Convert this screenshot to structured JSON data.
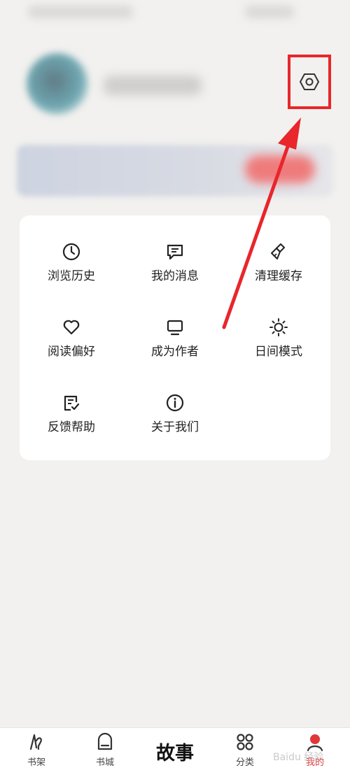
{
  "menu": {
    "items": [
      {
        "label": "浏览历史",
        "icon": "clock-icon"
      },
      {
        "label": "我的消息",
        "icon": "message-icon"
      },
      {
        "label": "清理缓存",
        "icon": "broom-icon"
      },
      {
        "label": "阅读偏好",
        "icon": "heart-icon"
      },
      {
        "label": "成为作者",
        "icon": "monitor-icon"
      },
      {
        "label": "日间模式",
        "icon": "sun-icon"
      },
      {
        "label": "反馈帮助",
        "icon": "feedback-icon"
      },
      {
        "label": "关于我们",
        "icon": "info-icon"
      }
    ]
  },
  "settings": {
    "icon": "settings-hexagon-icon"
  },
  "annotation": {
    "color": "#e8262b"
  },
  "tabbar": {
    "tabs": [
      {
        "label": "书架",
        "icon": "bookshelf-icon"
      },
      {
        "label": "书城",
        "icon": "bookstore-icon"
      },
      {
        "label": "故事"
      },
      {
        "label": "分类",
        "icon": "category-icon"
      },
      {
        "label": "我的",
        "icon": "profile-icon",
        "active": true
      }
    ],
    "active_color": "#e0383a"
  },
  "watermark": "Baidu 经验"
}
